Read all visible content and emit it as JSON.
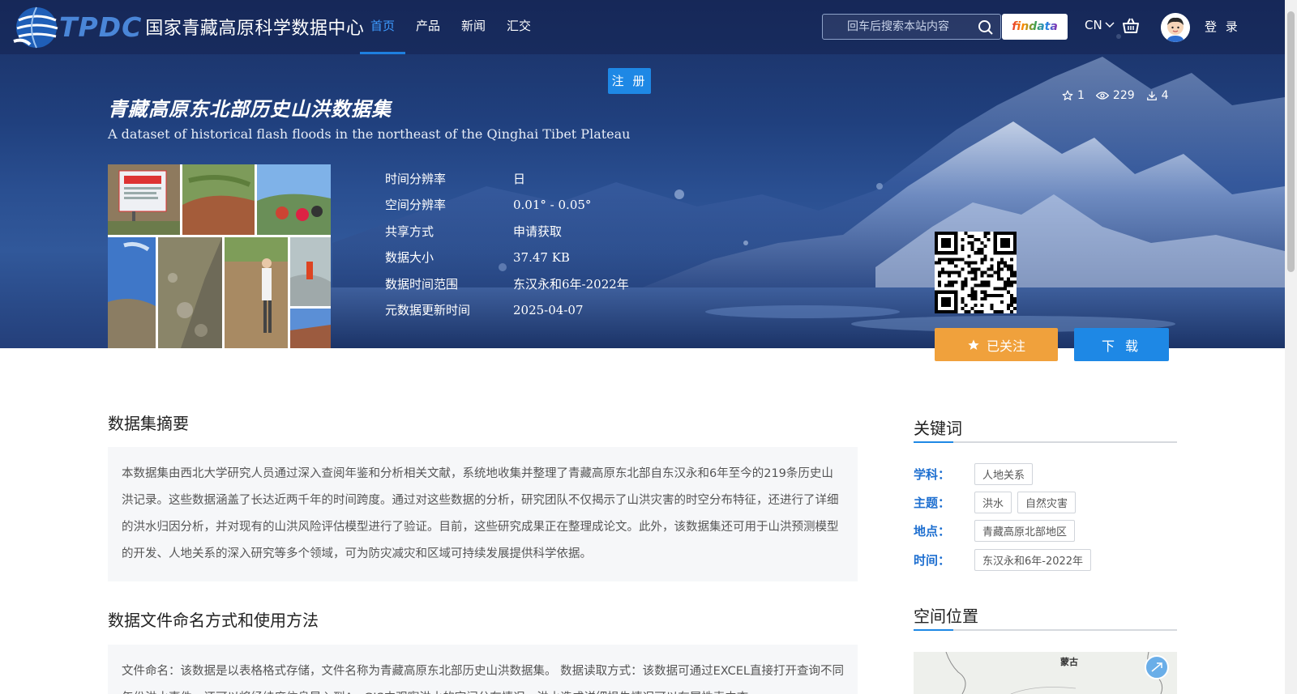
{
  "header": {
    "logo_text": "TPDC",
    "site_name": "国家青藏高原科学数据中心",
    "nav": [
      "首页",
      "产品",
      "新闻",
      "汇交"
    ],
    "active_nav": "首页",
    "search_placeholder": "回车后搜索本站内容",
    "findata_label": "findata",
    "lang": "CN",
    "login_label": "登 录"
  },
  "register_label": "注 册",
  "dataset": {
    "title": "青藏高原东北部历史山洪数据集",
    "subtitle": "A dataset of historical flash floods in the northeast of the Qinghai Tibet Plateau",
    "stars": "1",
    "views": "229",
    "downloads": "4",
    "meta": [
      {
        "k": "时间分辨率",
        "v": "日"
      },
      {
        "k": "空间分辨率",
        "v": "0.01° - 0.05°"
      },
      {
        "k": "共享方式",
        "v": "申请获取"
      },
      {
        "k": "数据大小",
        "v": "37.47 KB"
      },
      {
        "k": "数据时间范围",
        "v": "东汉永和6年-2022年"
      },
      {
        "k": "元数据更新时间",
        "v": "2025-04-07"
      }
    ],
    "follow_label": "已关注",
    "download_label": "下 载"
  },
  "abstract": {
    "heading": "数据集摘要",
    "text": "本数据集由西北大学研究人员通过深入查阅年鉴和分析相关文献，系统地收集并整理了青藏高原东北部自东汉永和6年至今的219条历史山洪记录。这些数据涵盖了长达近两千年的时间跨度。通过对这些数据的分析，研究团队不仅揭示了山洪灾害的时空分布特征，还进行了详细的洪水归因分析，并对现有的山洪风险评估模型进行了验证。目前，这些研究成果正在整理成论文。此外，该数据集还可用于山洪预测模型的开发、人地关系的深入研究等多个领域，可为防灾减灾和区域可持续发展提供科学依据。"
  },
  "naming": {
    "heading": "数据文件命名方式和使用方法",
    "text": "文件命名：该数据是以表格格式存储，文件名称为青藏高原东北部历史山洪数据集。 数据读取方式：该数据可通过EXCEL直接打开查询不同年份洪水事件，还可以将经纬度信息导入到ArcGIS中观察洪水的空间分布情况，洪水造成详细损失情况可以在属性表中查"
  },
  "keywords": {
    "heading": "关键词",
    "rows": [
      {
        "label": "学科：",
        "tags": [
          "人地关系"
        ]
      },
      {
        "label": "主题：",
        "tags": [
          "洪水",
          "自然灾害"
        ]
      },
      {
        "label": "地点：",
        "tags": [
          "青藏高原北部地区"
        ]
      },
      {
        "label": "时间：",
        "tags": [
          "东汉永和6年-2022年"
        ]
      }
    ]
  },
  "location": {
    "heading": "空间位置",
    "map_label": "蒙古"
  }
}
